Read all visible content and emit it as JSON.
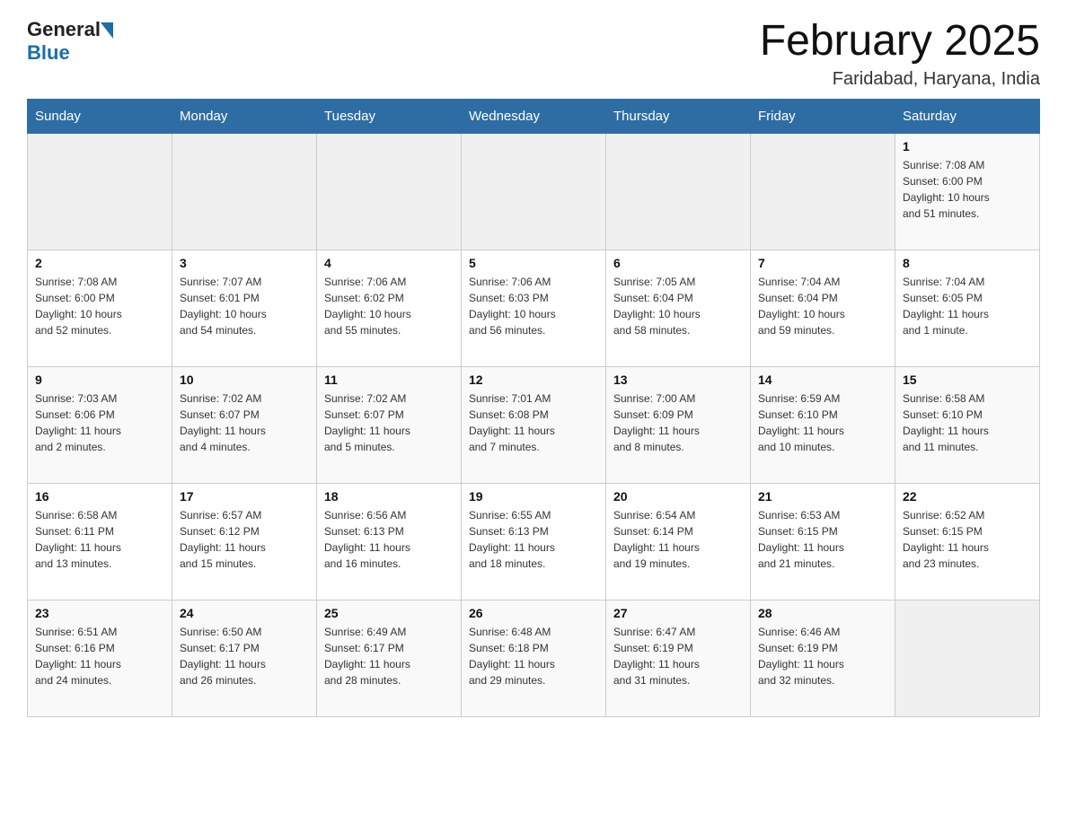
{
  "header": {
    "logo_general": "General",
    "logo_blue": "Blue",
    "month_title": "February 2025",
    "location": "Faridabad, Haryana, India"
  },
  "days_of_week": [
    "Sunday",
    "Monday",
    "Tuesday",
    "Wednesday",
    "Thursday",
    "Friday",
    "Saturday"
  ],
  "weeks": [
    [
      {
        "day": "",
        "info": ""
      },
      {
        "day": "",
        "info": ""
      },
      {
        "day": "",
        "info": ""
      },
      {
        "day": "",
        "info": ""
      },
      {
        "day": "",
        "info": ""
      },
      {
        "day": "",
        "info": ""
      },
      {
        "day": "1",
        "info": "Sunrise: 7:08 AM\nSunset: 6:00 PM\nDaylight: 10 hours\nand 51 minutes."
      }
    ],
    [
      {
        "day": "2",
        "info": "Sunrise: 7:08 AM\nSunset: 6:00 PM\nDaylight: 10 hours\nand 52 minutes."
      },
      {
        "day": "3",
        "info": "Sunrise: 7:07 AM\nSunset: 6:01 PM\nDaylight: 10 hours\nand 54 minutes."
      },
      {
        "day": "4",
        "info": "Sunrise: 7:06 AM\nSunset: 6:02 PM\nDaylight: 10 hours\nand 55 minutes."
      },
      {
        "day": "5",
        "info": "Sunrise: 7:06 AM\nSunset: 6:03 PM\nDaylight: 10 hours\nand 56 minutes."
      },
      {
        "day": "6",
        "info": "Sunrise: 7:05 AM\nSunset: 6:04 PM\nDaylight: 10 hours\nand 58 minutes."
      },
      {
        "day": "7",
        "info": "Sunrise: 7:04 AM\nSunset: 6:04 PM\nDaylight: 10 hours\nand 59 minutes."
      },
      {
        "day": "8",
        "info": "Sunrise: 7:04 AM\nSunset: 6:05 PM\nDaylight: 11 hours\nand 1 minute."
      }
    ],
    [
      {
        "day": "9",
        "info": "Sunrise: 7:03 AM\nSunset: 6:06 PM\nDaylight: 11 hours\nand 2 minutes."
      },
      {
        "day": "10",
        "info": "Sunrise: 7:02 AM\nSunset: 6:07 PM\nDaylight: 11 hours\nand 4 minutes."
      },
      {
        "day": "11",
        "info": "Sunrise: 7:02 AM\nSunset: 6:07 PM\nDaylight: 11 hours\nand 5 minutes."
      },
      {
        "day": "12",
        "info": "Sunrise: 7:01 AM\nSunset: 6:08 PM\nDaylight: 11 hours\nand 7 minutes."
      },
      {
        "day": "13",
        "info": "Sunrise: 7:00 AM\nSunset: 6:09 PM\nDaylight: 11 hours\nand 8 minutes."
      },
      {
        "day": "14",
        "info": "Sunrise: 6:59 AM\nSunset: 6:10 PM\nDaylight: 11 hours\nand 10 minutes."
      },
      {
        "day": "15",
        "info": "Sunrise: 6:58 AM\nSunset: 6:10 PM\nDaylight: 11 hours\nand 11 minutes."
      }
    ],
    [
      {
        "day": "16",
        "info": "Sunrise: 6:58 AM\nSunset: 6:11 PM\nDaylight: 11 hours\nand 13 minutes."
      },
      {
        "day": "17",
        "info": "Sunrise: 6:57 AM\nSunset: 6:12 PM\nDaylight: 11 hours\nand 15 minutes."
      },
      {
        "day": "18",
        "info": "Sunrise: 6:56 AM\nSunset: 6:13 PM\nDaylight: 11 hours\nand 16 minutes."
      },
      {
        "day": "19",
        "info": "Sunrise: 6:55 AM\nSunset: 6:13 PM\nDaylight: 11 hours\nand 18 minutes."
      },
      {
        "day": "20",
        "info": "Sunrise: 6:54 AM\nSunset: 6:14 PM\nDaylight: 11 hours\nand 19 minutes."
      },
      {
        "day": "21",
        "info": "Sunrise: 6:53 AM\nSunset: 6:15 PM\nDaylight: 11 hours\nand 21 minutes."
      },
      {
        "day": "22",
        "info": "Sunrise: 6:52 AM\nSunset: 6:15 PM\nDaylight: 11 hours\nand 23 minutes."
      }
    ],
    [
      {
        "day": "23",
        "info": "Sunrise: 6:51 AM\nSunset: 6:16 PM\nDaylight: 11 hours\nand 24 minutes."
      },
      {
        "day": "24",
        "info": "Sunrise: 6:50 AM\nSunset: 6:17 PM\nDaylight: 11 hours\nand 26 minutes."
      },
      {
        "day": "25",
        "info": "Sunrise: 6:49 AM\nSunset: 6:17 PM\nDaylight: 11 hours\nand 28 minutes."
      },
      {
        "day": "26",
        "info": "Sunrise: 6:48 AM\nSunset: 6:18 PM\nDaylight: 11 hours\nand 29 minutes."
      },
      {
        "day": "27",
        "info": "Sunrise: 6:47 AM\nSunset: 6:19 PM\nDaylight: 11 hours\nand 31 minutes."
      },
      {
        "day": "28",
        "info": "Sunrise: 6:46 AM\nSunset: 6:19 PM\nDaylight: 11 hours\nand 32 minutes."
      },
      {
        "day": "",
        "info": ""
      }
    ]
  ]
}
